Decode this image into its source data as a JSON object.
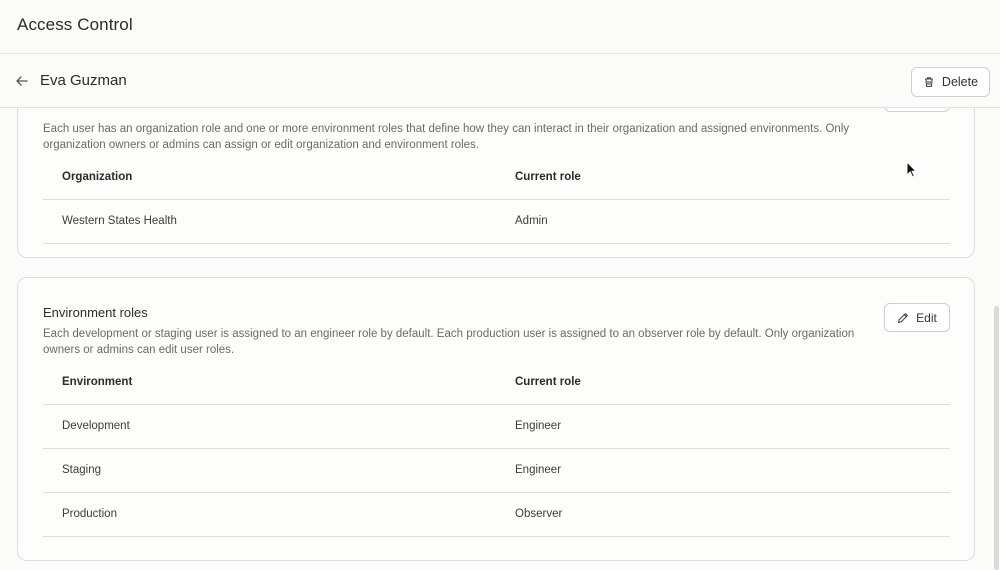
{
  "app": {
    "title": "Access Control"
  },
  "user": {
    "name": "Eva Guzman",
    "delete_label": "Delete"
  },
  "org_roles": {
    "description": "Each user has an organization role and one or more environment roles that define how they can interact in their organization and assigned environments. Only organization owners or admins can assign or edit organization and environment roles.",
    "columns": [
      "Organization",
      "Current role"
    ],
    "rows": [
      {
        "name": "Western States Health",
        "role": "Admin"
      }
    ]
  },
  "env_roles": {
    "title": "Environment roles",
    "edit_label": "Edit",
    "description": "Each development or staging user is assigned to an engineer role by default. Each production user is assigned to an observer role by default. Only organization owners or admins can edit user roles.",
    "columns": [
      "Environment",
      "Current role"
    ],
    "rows": [
      {
        "name": "Development",
        "role": "Engineer"
      },
      {
        "name": "Staging",
        "role": "Engineer"
      },
      {
        "name": "Production",
        "role": "Observer"
      }
    ]
  },
  "icons": {
    "back": "arrow-left-icon",
    "delete": "trash-icon",
    "edit": "pencil-icon"
  }
}
